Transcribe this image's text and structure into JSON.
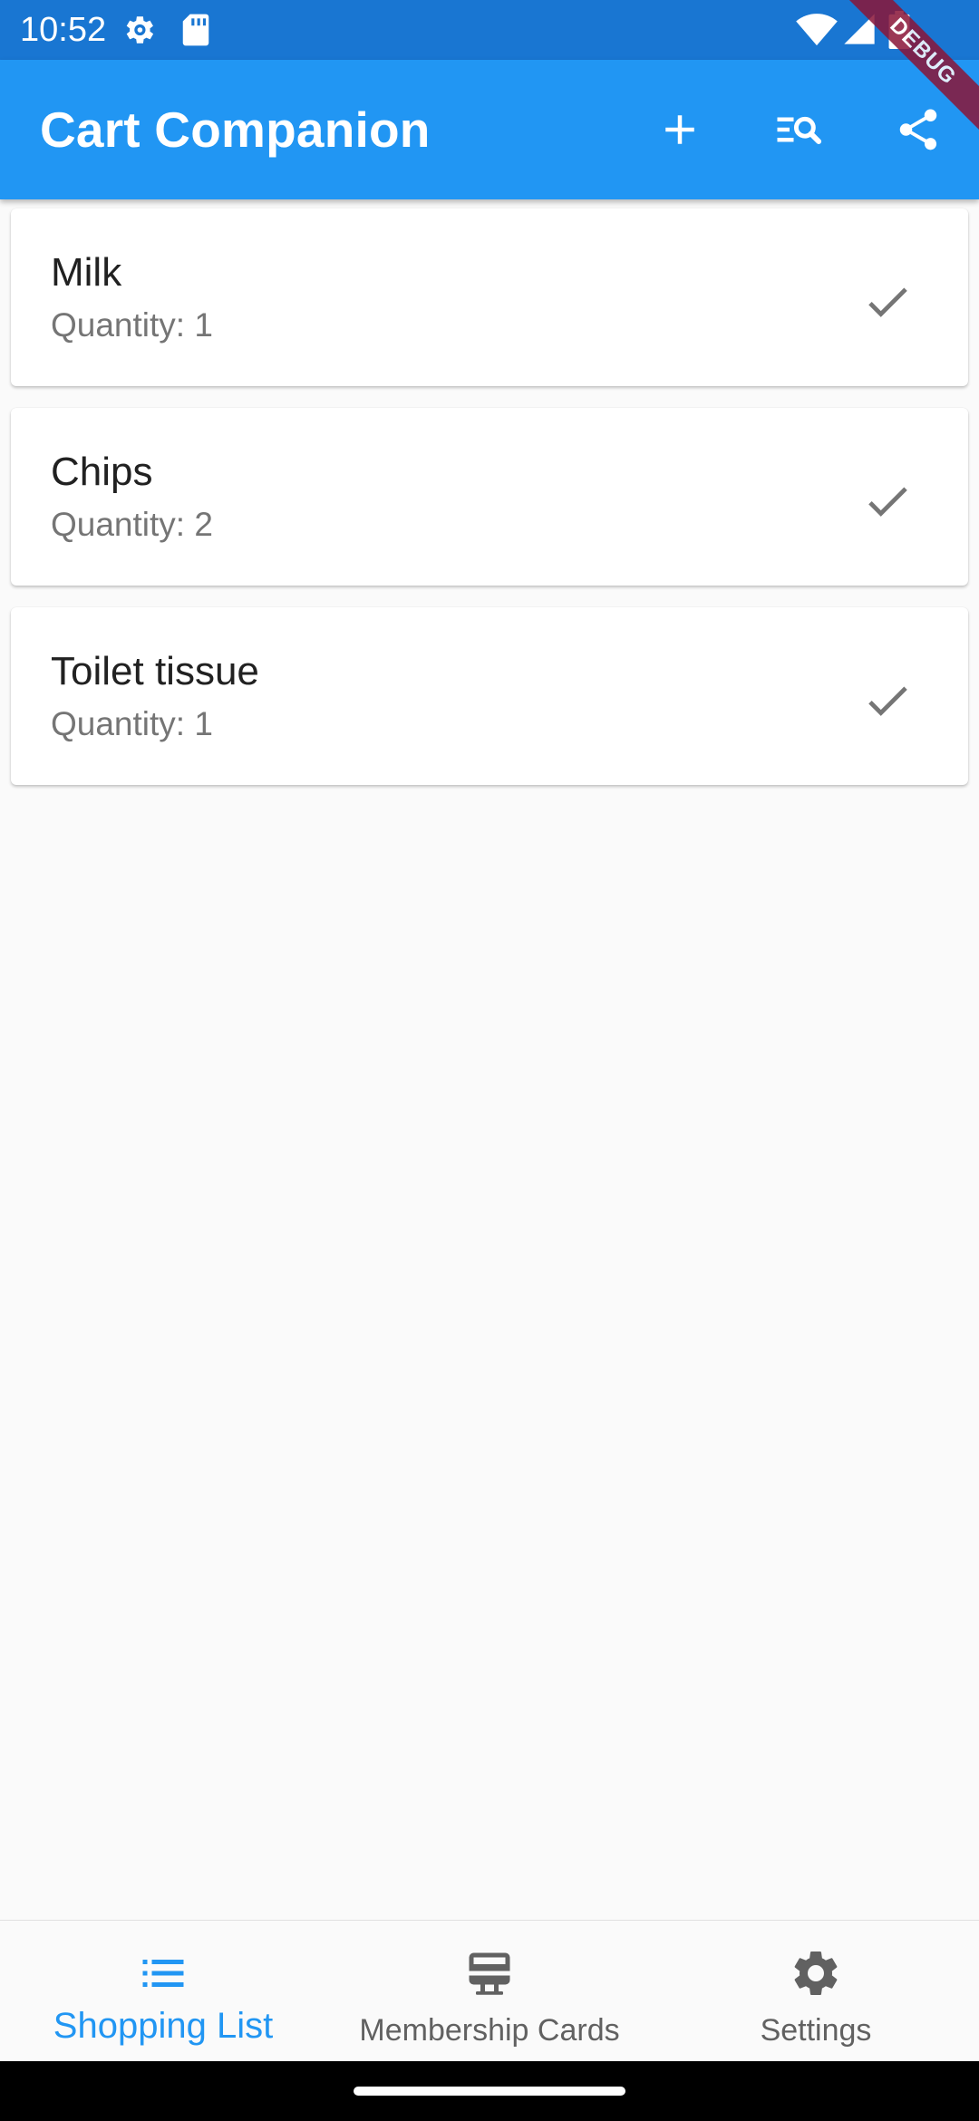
{
  "status_bar": {
    "time": "10:52",
    "icons": [
      "settings-icon",
      "sd-card-icon",
      "wifi-icon",
      "signal-icon",
      "battery-icon"
    ]
  },
  "debug_banner": "DEBUG",
  "app_bar": {
    "title": "Cart Companion",
    "actions": [
      "add-icon",
      "search-list-icon",
      "share-icon"
    ],
    "color": "#2196f3"
  },
  "items": [
    {
      "name": "Milk",
      "quantity": "Quantity: 1"
    },
    {
      "name": "Chips",
      "quantity": "Quantity: 2"
    },
    {
      "name": "Toilet tissue",
      "quantity": "Quantity: 1"
    }
  ],
  "bottom_nav": {
    "items": [
      {
        "label": "Shopping List",
        "icon": "list-icon",
        "active": true
      },
      {
        "label": "Membership Cards",
        "icon": "card-icon",
        "active": false
      },
      {
        "label": "Settings",
        "icon": "gear-icon",
        "active": false
      }
    ],
    "active_color": "#2196f3"
  }
}
